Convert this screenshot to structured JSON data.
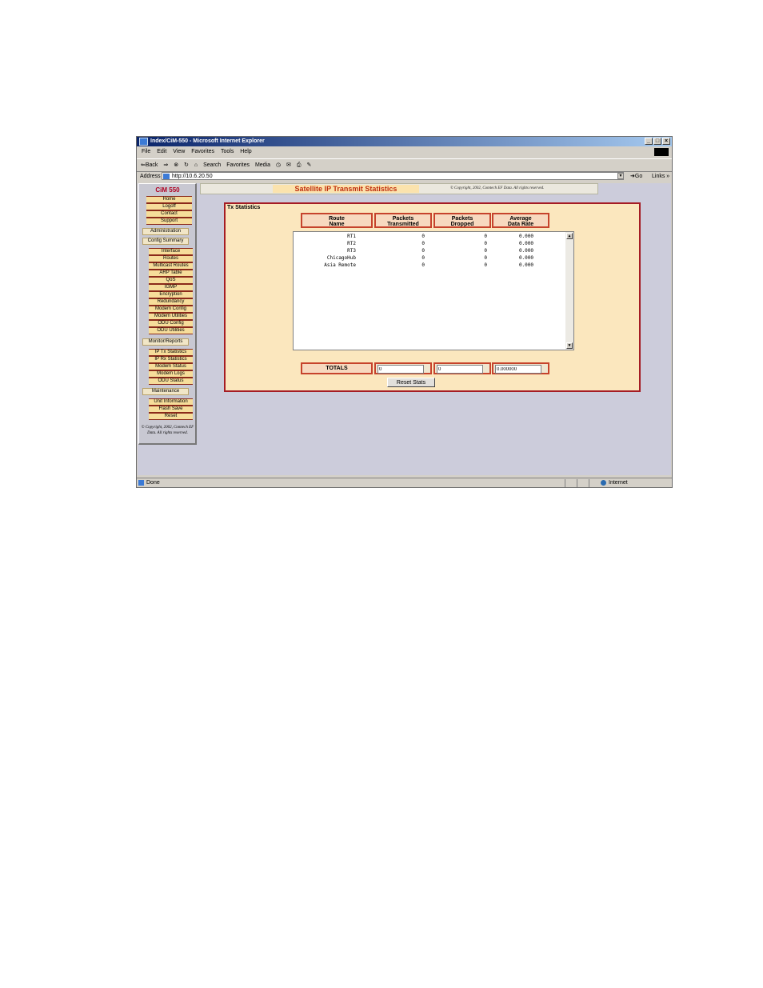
{
  "window": {
    "title": "Index/CiM-550 - Microsoft Internet Explorer",
    "controls": [
      "_",
      "□",
      "×"
    ]
  },
  "menu": [
    "File",
    "Edit",
    "View",
    "Favorites",
    "Tools",
    "Help"
  ],
  "toolbar": {
    "back": "⇐Back",
    "forward": "⇒",
    "search": "Search",
    "favorites": "Favorites",
    "media": "Media"
  },
  "address": {
    "label": "Address",
    "url": "http://10.6.20.50",
    "go": "Go",
    "links": "Links"
  },
  "sidebar": {
    "logo": "CiM 550",
    "top_items": [
      "Home",
      "Logoff",
      "Contact",
      "Support"
    ],
    "admin": "Administration",
    "config_summary": "Config Summary",
    "config_items": [
      "Interface",
      "Routes",
      "Multicast Routes",
      "ARP Table",
      "QoS",
      "IGMP",
      "Encryption",
      "Redundancy",
      "Modem Config",
      "Modem Utilities",
      "ODU Config",
      "ODU Utilities"
    ],
    "monitor": "Monitor/Reports",
    "monitor_items": [
      "IP Tx Statistics",
      "IP Rx Statistics",
      "Modem Status",
      "Modem Logs",
      "ODU Status"
    ],
    "maintenance": "Maintenance",
    "maintenance_items": [
      "Unit Information",
      "Flash Save",
      "Reset"
    ],
    "copyright": "© Copyright, 2002, Comtech EF Data. All rights reserved."
  },
  "header": {
    "title": "Satellite IP Transmit Statistics",
    "copyright": "© Copyright, 2002, Comtech EF Data. All rights reserved."
  },
  "stats": {
    "heading": "Tx Statistics",
    "columns": [
      {
        "line1": "Route",
        "line2": "Name"
      },
      {
        "line1": "Packets",
        "line2": "Transmitted"
      },
      {
        "line1": "Packets",
        "line2": "Dropped"
      },
      {
        "line1": "Average",
        "line2": "Data Rate"
      }
    ],
    "rows": [
      {
        "name": "RT1",
        "transmitted": "0",
        "dropped": "0",
        "rate": "0.000"
      },
      {
        "name": "RT2",
        "transmitted": "0",
        "dropped": "0",
        "rate": "0.000"
      },
      {
        "name": "RT3",
        "transmitted": "0",
        "dropped": "0",
        "rate": "0.000"
      },
      {
        "name": "ChicagoHub",
        "transmitted": "0",
        "dropped": "0",
        "rate": "0.000"
      },
      {
        "name": "Asia Remote",
        "transmitted": "0",
        "dropped": "0",
        "rate": "0.000"
      }
    ],
    "totals_label": "TOTALS",
    "totals": {
      "transmitted": "0",
      "dropped": "0",
      "rate": "0.000000"
    },
    "reset_button": "Reset Stats"
  },
  "status": {
    "left": "Done",
    "zone": "Internet"
  }
}
